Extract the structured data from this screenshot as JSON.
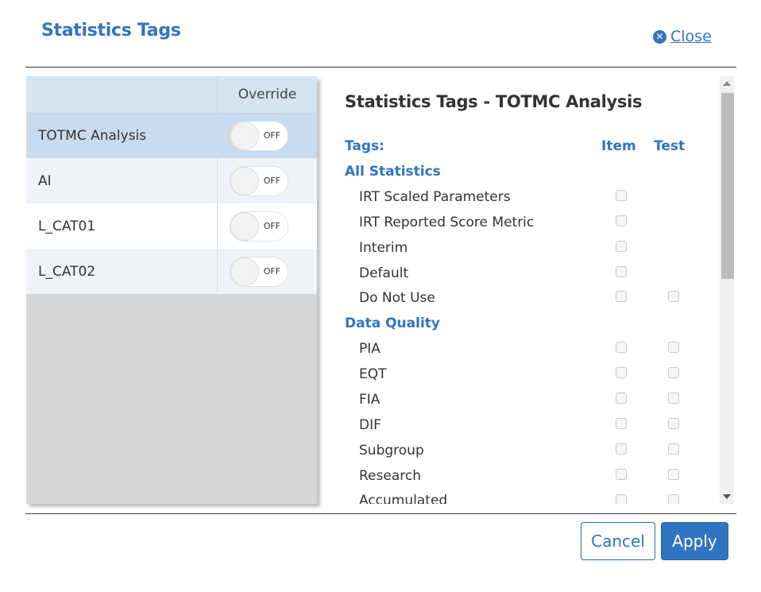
{
  "dialog": {
    "title": "Statistics Tags",
    "close_label": "Close",
    "close_icon": "times-circle-icon"
  },
  "left_table": {
    "header": {
      "name": "",
      "override": "Override"
    },
    "rows": [
      {
        "name": "TOTMC Analysis",
        "override": "OFF",
        "selected": true
      },
      {
        "name": "AI",
        "override": "OFF",
        "selected": false
      },
      {
        "name": "L_CAT01",
        "override": "OFF",
        "selected": false
      },
      {
        "name": "L_CAT02",
        "override": "OFF",
        "selected": false
      }
    ]
  },
  "detail": {
    "title": "Statistics Tags - TOTMC Analysis",
    "tags_label": "Tags:",
    "item_label": "Item",
    "test_label": "Test",
    "groups": [
      {
        "name": "All Statistics",
        "tags": [
          {
            "label": "IRT Scaled Parameters",
            "item": false,
            "test": null
          },
          {
            "label": "IRT Reported Score Metric",
            "item": false,
            "test": null
          },
          {
            "label": "Interim",
            "item": false,
            "test": null
          },
          {
            "label": "Default",
            "item": false,
            "test": null
          },
          {
            "label": "Do Not Use",
            "item": false,
            "test": false
          }
        ]
      },
      {
        "name": "Data Quality",
        "tags": [
          {
            "label": "PIA",
            "item": false,
            "test": false
          },
          {
            "label": "EQT",
            "item": false,
            "test": false
          },
          {
            "label": "FIA",
            "item": false,
            "test": false
          },
          {
            "label": "DIF",
            "item": false,
            "test": false
          },
          {
            "label": "Subgroup",
            "item": false,
            "test": false
          },
          {
            "label": "Research",
            "item": false,
            "test": false
          },
          {
            "label": "Accumulated",
            "item": false,
            "test": false
          }
        ]
      }
    ]
  },
  "footer": {
    "cancel_label": "Cancel",
    "apply_label": "Apply"
  },
  "colors": {
    "accent": "#3174c1",
    "selected_row": "#c9dbee",
    "header_row": "#d6e3f1"
  }
}
